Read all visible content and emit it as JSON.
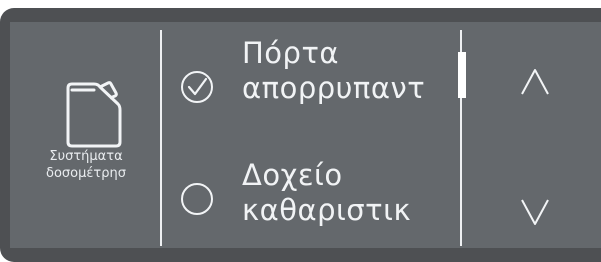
{
  "dosing": {
    "icon": "canister-icon",
    "label_line1": "Συστήματα",
    "label_line2": "δοσομέτρησ"
  },
  "options": [
    {
      "line1": "Πόρτα",
      "line2": "απορρυπαντ",
      "checked": true,
      "icon": "checkmark-circle-icon"
    },
    {
      "line1": "Δοχείο",
      "line2": "καθαριστικ",
      "checked": false,
      "icon": "empty-circle-icon"
    }
  ],
  "navigation": {
    "up_icon": "chevron-up-icon",
    "down_icon": "chevron-down-icon"
  },
  "colors": {
    "bezel": "#4e5053",
    "screen": "#64686c",
    "foreground": "#f1f3f5"
  }
}
